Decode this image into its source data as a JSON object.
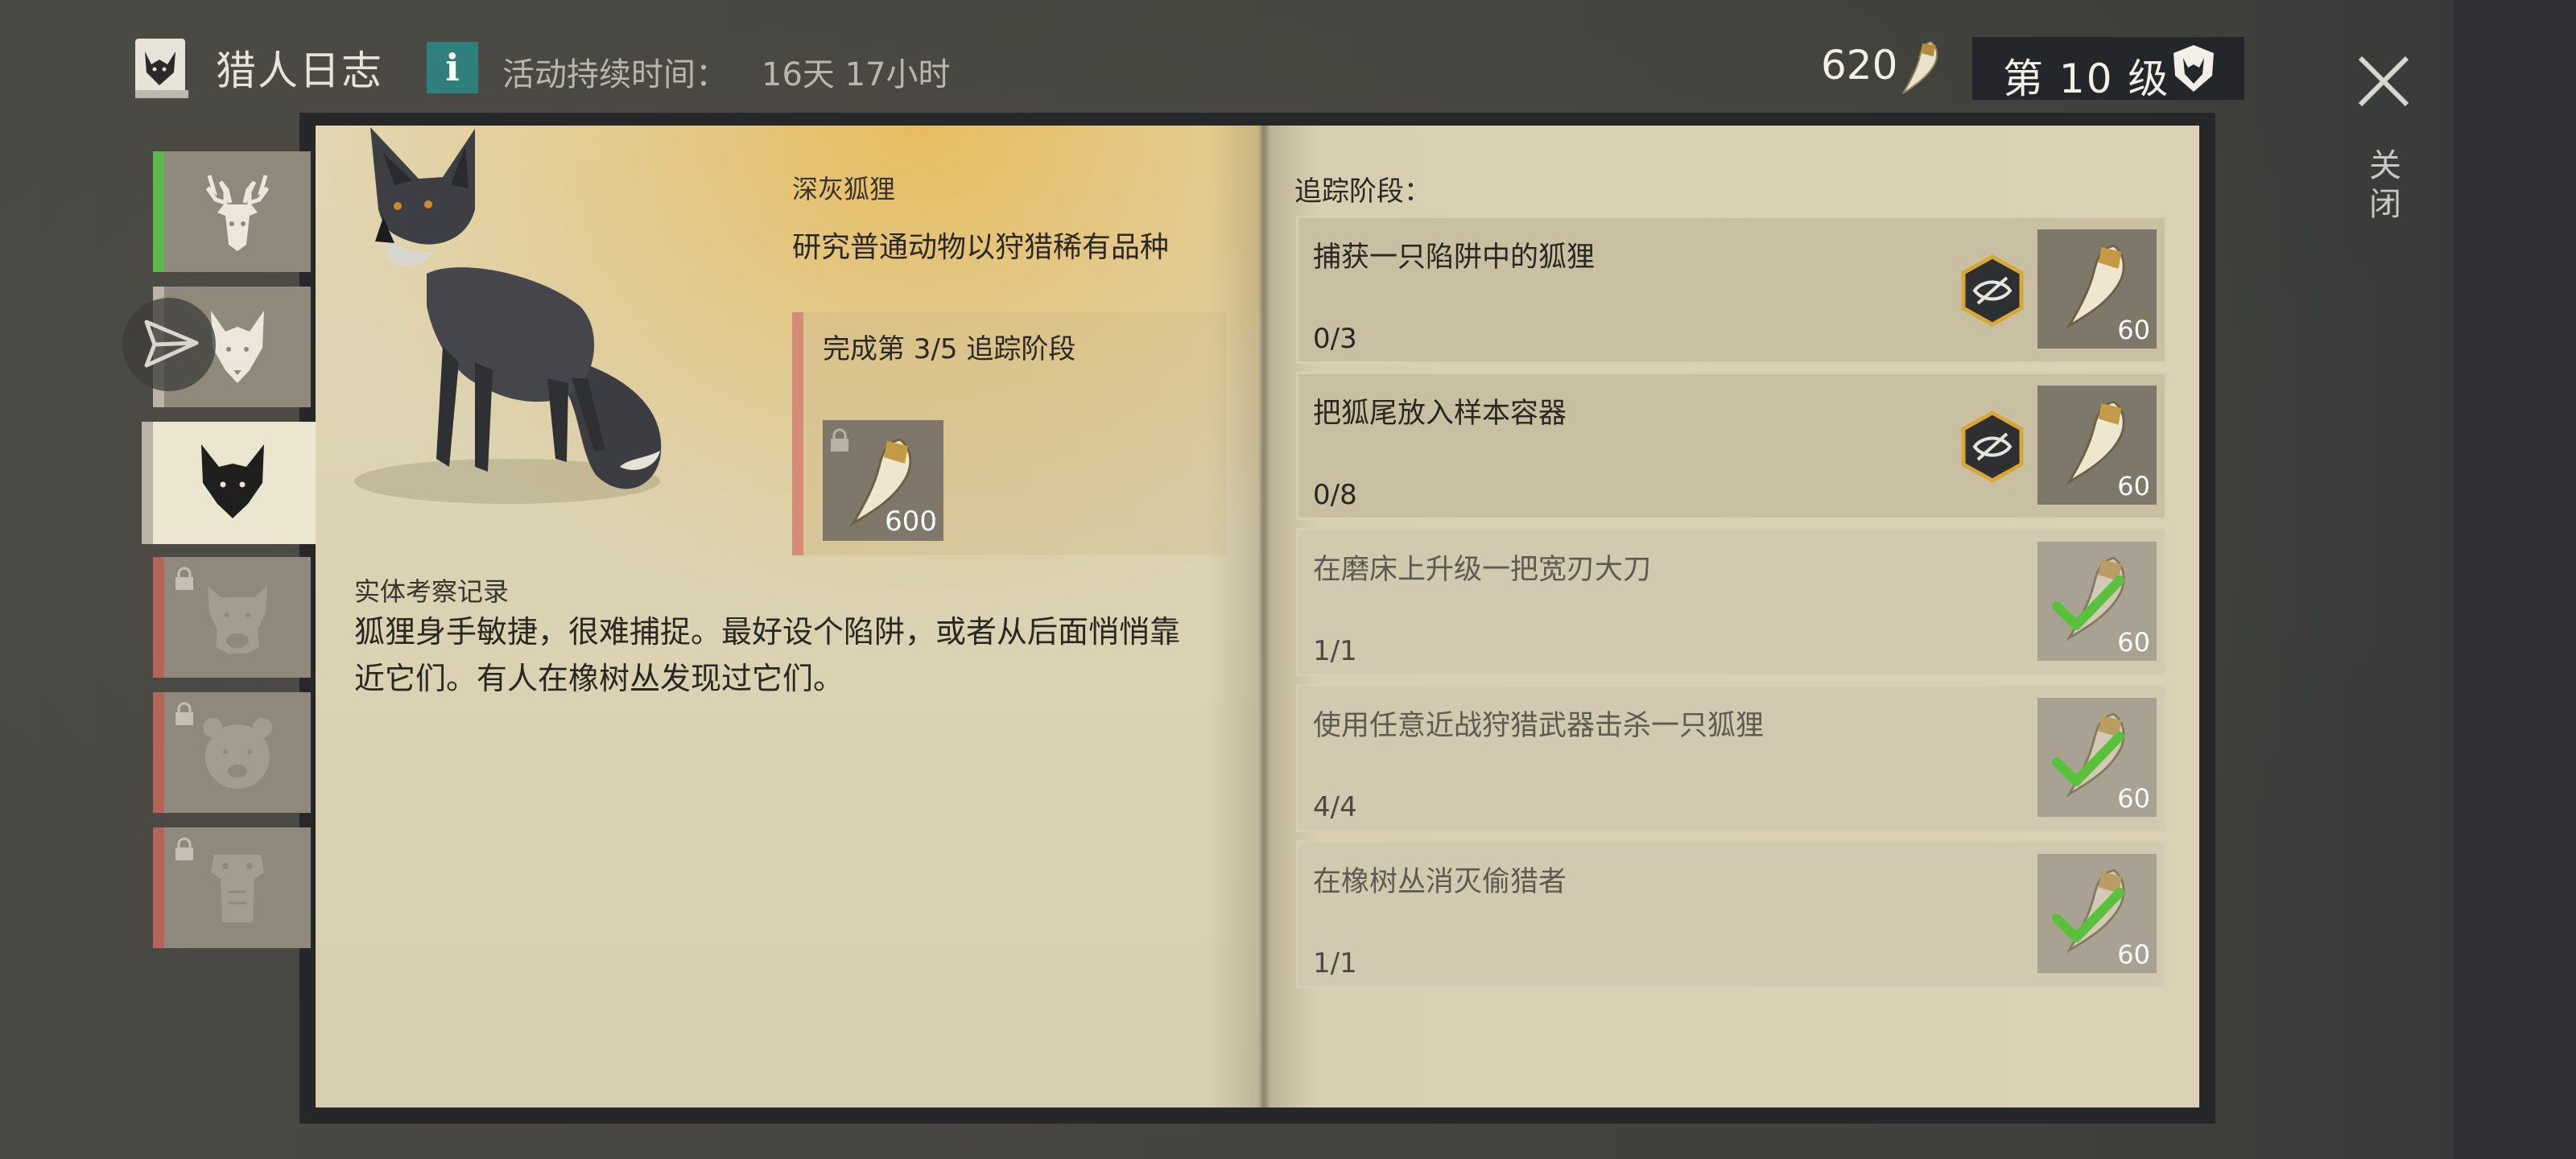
{
  "header": {
    "title": "猎人日志",
    "info_label": "i",
    "duration_label": "活动持续时间：",
    "duration_value": "16天 17小时",
    "currency_amount": "620",
    "level_label": "第 10 级",
    "close_label": "关闭"
  },
  "animal_tabs": [
    {
      "name": "deer",
      "state": "completed",
      "locked": false
    },
    {
      "name": "wolf",
      "state": "in-progress",
      "locked": false
    },
    {
      "name": "fox",
      "state": "selected",
      "locked": false
    },
    {
      "name": "boar",
      "state": "locked",
      "locked": true
    },
    {
      "name": "bear",
      "state": "locked",
      "locked": true
    },
    {
      "name": "alligator",
      "state": "locked",
      "locked": true
    }
  ],
  "left_page": {
    "animal_name": "深灰狐狸",
    "animal_desc": "研究普通动物以狩猎稀有品种",
    "progress_title": "完成第 3/5 追踪阶段",
    "reward_count": "600",
    "field_notes_title": "实体考察记录",
    "field_notes_text": "狐狸身手敏捷，很难捕捉。最好设个陷阱，或者从后面悄悄靠近它们。有人在橡树丛发现过它们。"
  },
  "right_page": {
    "heading": "追踪阶段：",
    "tasks": [
      {
        "label": "捕获一只陷阱中的狐狸",
        "progress": "0/3",
        "reward": "60",
        "completed": false,
        "hidden": true
      },
      {
        "label": "把狐尾放入样本容器",
        "progress": "0/8",
        "reward": "60",
        "completed": false,
        "hidden": true
      },
      {
        "label": "在磨床上升级一把宽刃大刀",
        "progress": "1/1",
        "reward": "60",
        "completed": true,
        "hidden": false
      },
      {
        "label": "使用任意近战狩猎武器击杀一只狐狸",
        "progress": "4/4",
        "reward": "60",
        "completed": true,
        "hidden": false
      },
      {
        "label": "在橡树丛消灭偷猎者",
        "progress": "1/1",
        "reward": "60",
        "completed": true,
        "hidden": false
      }
    ]
  },
  "colors": {
    "accent_completed": "#5cb84a",
    "accent_locked": "#b3655a",
    "accent_progress": "#d48b78",
    "info_teal": "#2f7f7c",
    "check_green": "#58c23c"
  }
}
